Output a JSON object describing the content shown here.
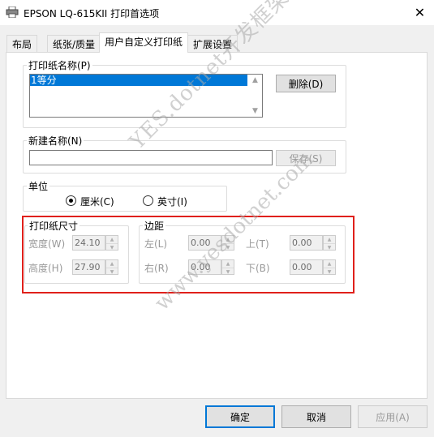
{
  "window": {
    "title": "EPSON LQ-615KII 打印首选项"
  },
  "tabs": [
    {
      "label": "布局"
    },
    {
      "label": "纸张/质量"
    },
    {
      "label": "用户自定义打印纸"
    },
    {
      "label": "扩展设置"
    }
  ],
  "paper_name_group": {
    "legend": "打印纸名称(P)",
    "items": [
      "1等分"
    ],
    "delete_button": "删除(D)"
  },
  "new_name_group": {
    "legend": "新建名称(N)",
    "value": "",
    "save_button": "保存(S)"
  },
  "unit_group": {
    "legend": "单位",
    "options": [
      {
        "label": "厘米(C)",
        "selected": true
      },
      {
        "label": "英寸(I)",
        "selected": false
      }
    ]
  },
  "paper_size_group": {
    "legend": "打印纸尺寸",
    "width_label": "宽度(W)",
    "width_value": "24.10",
    "height_label": "高度(H)",
    "height_value": "27.90"
  },
  "margin_group": {
    "legend": "边距",
    "left_label": "左(L)",
    "left_value": "0.00",
    "top_label": "上(T)",
    "top_value": "0.00",
    "right_label": "右(R)",
    "right_value": "0.00",
    "bottom_label": "下(B)",
    "bottom_value": "0.00"
  },
  "footer": {
    "ok": "确定",
    "cancel": "取消",
    "apply": "应用(A)"
  },
  "watermark": {
    "line1": "YES.dotnet开发框架",
    "line2": "www.yesdotnet.com"
  },
  "colors": {
    "selection": "#0078d7",
    "highlight_border": "#e0201b",
    "default_button_border": "#0078d7"
  }
}
